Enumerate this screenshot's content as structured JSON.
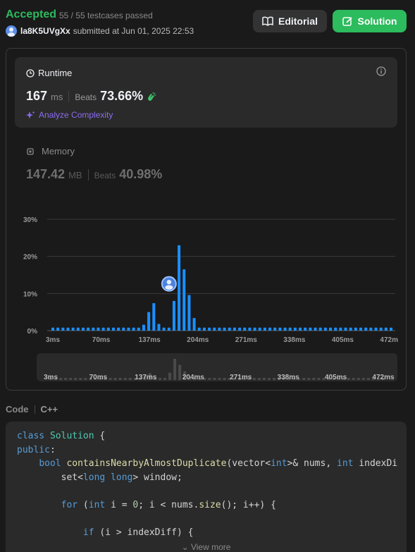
{
  "header": {
    "status": "Accepted",
    "testcases": "55 / 55 testcases passed",
    "username": "la8K5UVgXx",
    "submitted_text": "submitted at Jun 01, 2025 22:53",
    "editorial_label": "Editorial",
    "solution_label": "Solution"
  },
  "runtime": {
    "title": "Runtime",
    "value": "167",
    "unit": "ms",
    "beats_label": "Beats",
    "beats_value": "73.66%",
    "analyze_label": "Analyze Complexity"
  },
  "memory": {
    "title": "Memory",
    "value": "147.42",
    "unit": "MB",
    "beats_label": "Beats",
    "beats_value": "40.98%"
  },
  "colors": {
    "accent_green": "#2cbb5d",
    "bar_blue": "#1a90ff",
    "analyze_purple": "#8c6cf2"
  },
  "chart_data": {
    "type": "bar",
    "ylabel_ticks": [
      "0%",
      "10%",
      "20%",
      "30%"
    ],
    "xtick_labels": [
      "3ms",
      "70ms",
      "137ms",
      "204ms",
      "271ms",
      "338ms",
      "405ms",
      "472ms"
    ],
    "ylim": [
      0,
      30
    ],
    "grid": true,
    "marker_value": "167ms",
    "x": [
      3,
      10,
      17,
      24,
      31,
      38,
      45,
      52,
      59,
      66,
      73,
      80,
      87,
      94,
      101,
      108,
      115,
      122,
      129,
      136,
      143,
      150,
      157,
      164,
      171,
      178,
      185,
      192,
      199,
      206,
      213,
      220,
      227,
      234,
      241,
      248,
      255,
      262,
      269,
      276,
      283,
      290,
      297,
      304,
      311,
      318,
      325,
      332,
      339,
      346,
      353,
      360,
      367,
      374,
      381,
      388,
      395,
      402,
      409,
      416,
      423,
      430,
      437,
      444,
      451,
      458,
      465,
      472
    ],
    "values": [
      0.8,
      0.8,
      0.8,
      0.8,
      0.8,
      0.8,
      0.8,
      0.8,
      0.8,
      0.8,
      0.8,
      0.8,
      0.8,
      0.8,
      0.8,
      0.8,
      0.8,
      0.8,
      1.6,
      5,
      7.4,
      1.8,
      0.8,
      0.8,
      8,
      23,
      16.5,
      9.6,
      3.4,
      0.8,
      0.8,
      0.8,
      0.8,
      0.8,
      0.8,
      0.8,
      0.8,
      0.8,
      0.8,
      0.8,
      0.8,
      0.8,
      0.8,
      0.8,
      0.8,
      0.8,
      0.8,
      0.8,
      0.8,
      0.8,
      0.8,
      0.8,
      0.8,
      0.8,
      0.8,
      0.8,
      0.8,
      0.8,
      0.8,
      0.8,
      0.8,
      0.8,
      0.8,
      0.8,
      0.8,
      0.8,
      0.8,
      0.8
    ]
  },
  "code": {
    "label": "Code",
    "language": "C++",
    "view_more": "View more"
  }
}
